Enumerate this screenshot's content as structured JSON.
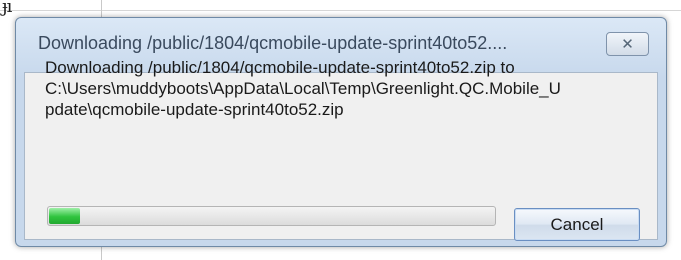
{
  "background": {
    "glyph": "ɟı"
  },
  "dialog": {
    "title": "Downloading /public/1804/qcmobile-update-sprint40to52....",
    "close_icon": "close-icon",
    "message_lines": [
      "Downloading /public/1804/qcmobile-update-sprint40to52.zip to",
      "C:\\Users\\muddyboots\\AppData\\Local\\Temp\\Greenlight.QC.Mobile_U",
      "pdate\\qcmobile-update-sprint40to52.zip"
    ],
    "progress_fraction": 0.07,
    "progress_color": "#2fc43e",
    "cancel_label": "Cancel"
  }
}
